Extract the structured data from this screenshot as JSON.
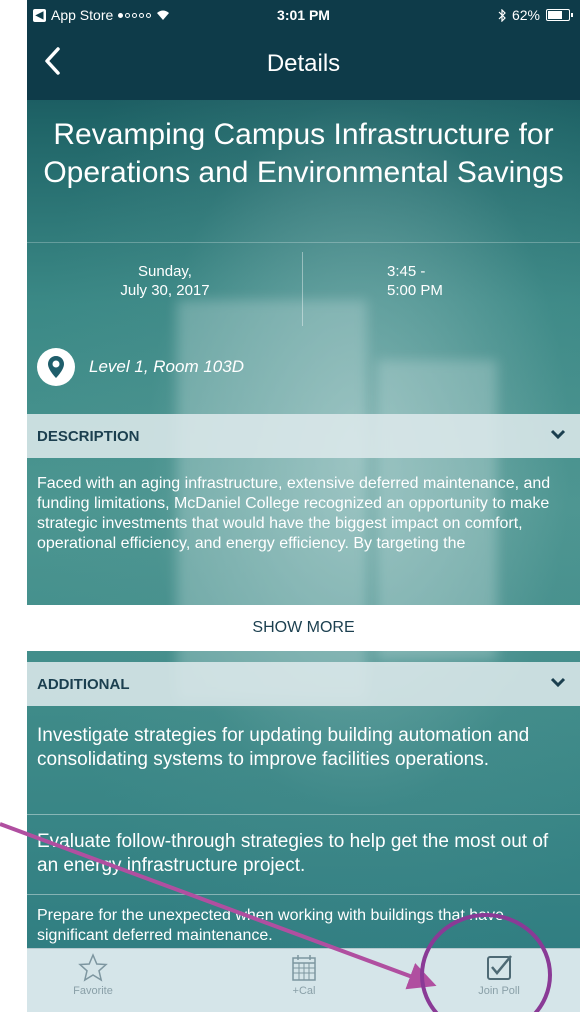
{
  "status_bar": {
    "carrier": "App Store",
    "time": "3:01 PM",
    "battery": "62%",
    "battery_level": 0.62
  },
  "nav": {
    "title": "Details",
    "back_icon": "chevron-left-icon"
  },
  "session": {
    "title": "Revamping Campus Infrastructure for Operations and Environmental Savings",
    "date_line1": "Sunday,",
    "date_line2": "July 30, 2017",
    "time_line1": "3:45 -",
    "time_line2": "5:00 PM",
    "location": "Level 1, Room 103D"
  },
  "description": {
    "header": "DESCRIPTION",
    "text": "Faced with an aging infrastructure, extensive deferred maintenance, and funding limitations, McDaniel College recognized an opportunity to make strategic investments that would have the biggest impact on comfort, operational efficiency, and energy efficiency. By targeting the",
    "show_more": "SHOW MORE"
  },
  "additional": {
    "header": "ADDITIONAL",
    "items": [
      "Investigate strategies for updating building automation and consolidating systems to improve facilities operations.",
      "Evaluate follow-through strategies to help get the most out of an energy infrastructure project.",
      "Prepare for the unexpected when working with buildings that have significant deferred maintenance."
    ]
  },
  "tabbar": {
    "items": [
      {
        "label": "Favorite",
        "icon": "star-icon"
      },
      {
        "label": "+Cal",
        "icon": "calendar-icon"
      },
      {
        "label": "Join Poll",
        "icon": "checkbox-icon"
      }
    ]
  },
  "colors": {
    "nav_bg": "#0e3b49",
    "annotation": "#b04fa0",
    "section_header_text": "#1b3f4f"
  }
}
